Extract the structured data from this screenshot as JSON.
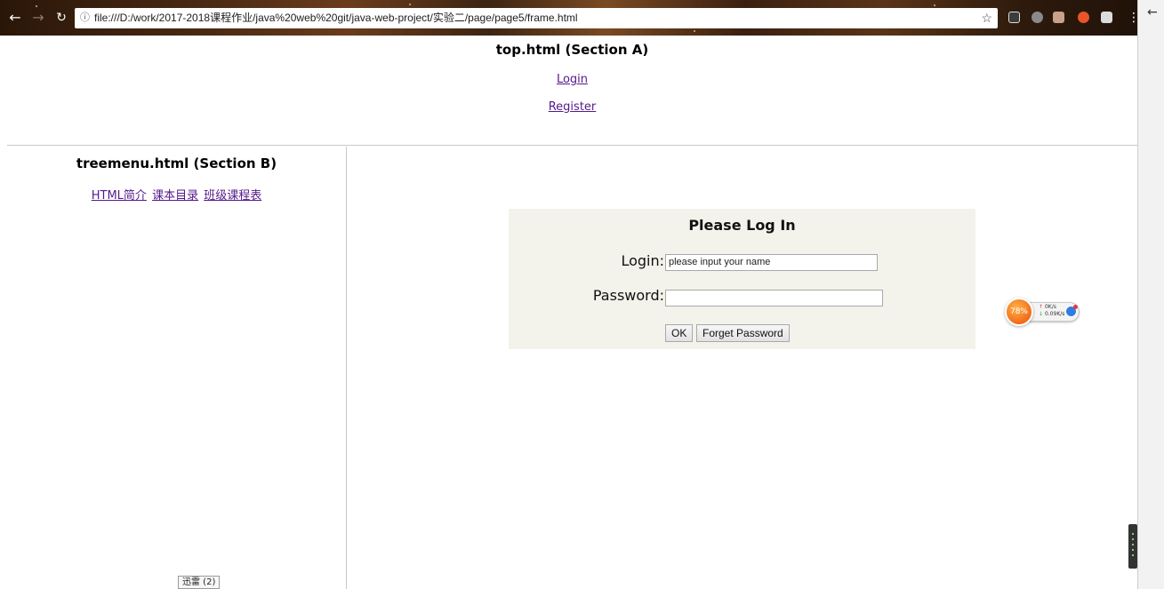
{
  "browser": {
    "url": "file:///D:/work/2017-2018课程作业/java%20web%20git/java-web-project/实验二/page/page5/frame.html",
    "info_icon": "info-circle-icon",
    "bookmark_icon": "star-icon"
  },
  "top_frame": {
    "heading": "top.html (Section A)",
    "links": [
      "Login",
      "Register"
    ]
  },
  "tree_menu": {
    "heading": "treemenu.html (Section B)",
    "links": [
      "HTML简介",
      "课本目录",
      "班级课程表"
    ],
    "status_badge": "迅雷 (2)"
  },
  "login_form": {
    "title": "Please Log In",
    "login_label": "Login:",
    "login_value": "please input your name",
    "password_label": "Password:",
    "password_value": "",
    "ok_button": "OK",
    "forget_button": "Forget Password"
  },
  "speed_widget": {
    "percent": "78%",
    "upload": "0K/s",
    "download": "0.09K/s"
  },
  "colors": {
    "link": "#551a8b",
    "panel_bg": "#f3f3eb",
    "widget_orange": "#f26a1b"
  }
}
